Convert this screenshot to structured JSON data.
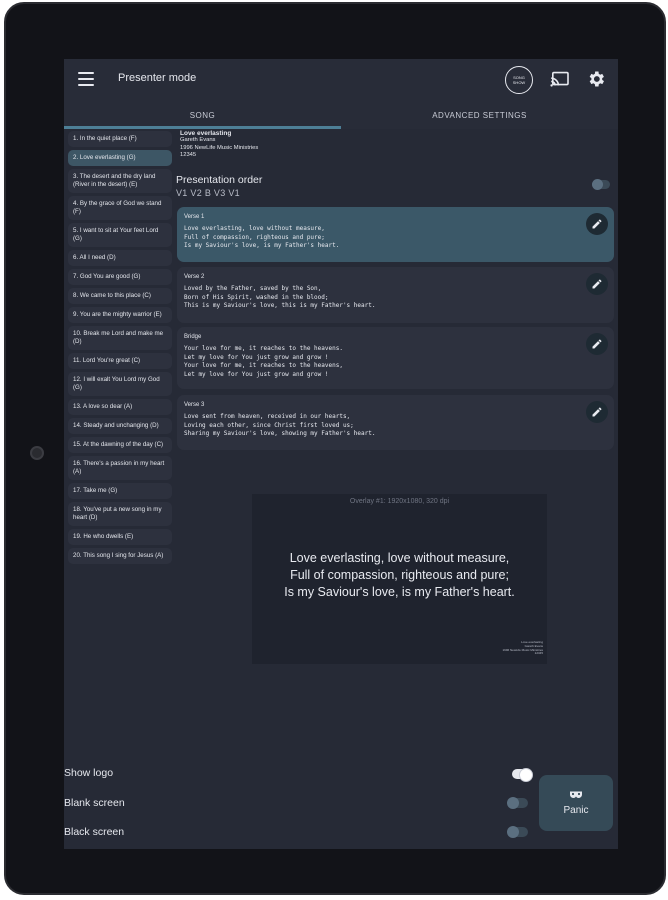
{
  "app": {
    "title": "Presenter mode",
    "logo_line1": "SONG",
    "logo_line2": "SHOW"
  },
  "icons": {
    "menu": "menu-icon",
    "cast": "cast-icon",
    "settings": "gear-icon",
    "edit": "pencil-icon",
    "panic": "mask-icon"
  },
  "tabs": [
    {
      "label": "SONG",
      "selected": true
    },
    {
      "label": "ADVANCED SETTINGS",
      "selected": false
    }
  ],
  "songs": [
    {
      "label": "1. In the quiet place (F)",
      "selected": false
    },
    {
      "label": "2. Love everlasting (G)",
      "selected": true
    },
    {
      "label": "3. The desert and the dry land (River in the desert) (E)",
      "selected": false
    },
    {
      "label": "4. By the grace of God we stand (F)",
      "selected": false
    },
    {
      "label": "5. I want to sit at Your feet Lord (G)",
      "selected": false
    },
    {
      "label": "6. All I need (D)",
      "selected": false
    },
    {
      "label": "7. God You are good (G)",
      "selected": false
    },
    {
      "label": "8. We came to this place (C)",
      "selected": false
    },
    {
      "label": "9. You are the mighty warrior (E)",
      "selected": false
    },
    {
      "label": "10. Break me Lord and make me (D)",
      "selected": false
    },
    {
      "label": "11. Lord You're great (C)",
      "selected": false
    },
    {
      "label": "12. I will exalt You Lord my God (G)",
      "selected": false
    },
    {
      "label": "13. A love so dear (A)",
      "selected": false
    },
    {
      "label": "14. Steady and unchanging (D)",
      "selected": false
    },
    {
      "label": "15. At the dawning of the day (C)",
      "selected": false
    },
    {
      "label": "16. There's a passion in my heart (A)",
      "selected": false
    },
    {
      "label": "17. Take me (G)",
      "selected": false
    },
    {
      "label": "18. You've put a new song in my heart (D)",
      "selected": false
    },
    {
      "label": "19. He who dwells (E)",
      "selected": false
    },
    {
      "label": "20. This song I sing for Jesus (A)",
      "selected": false
    }
  ],
  "song_info": {
    "title": "Love everlasting",
    "author": "Gareth Evans",
    "copyright": "1996 NewLife Music Ministries",
    "number": "12345"
  },
  "presentation_order": {
    "title": "Presentation order",
    "sequence": "V1 V2 B V3 V1",
    "enabled": false
  },
  "verses": [
    {
      "label": "Verse 1",
      "lines": [
        "Love everlasting, love without measure,",
        "Full of compassion, righteous and pure;",
        "Is my Saviour's love, is my Father's heart."
      ],
      "active": true
    },
    {
      "label": "Verse 2",
      "lines": [
        "Loved by the Father, saved by the Son,",
        "Born of His Spirit, washed in the blood;",
        "This is my Saviour's love, this is my Father's heart."
      ],
      "active": false
    },
    {
      "label": "Bridge",
      "lines": [
        "Your love for me, it reaches to the heavens.",
        "Let my love for You just grow and grow !",
        "Your love for me, it reaches to the heavens,",
        "Let my love for You just grow and grow !"
      ],
      "active": false
    },
    {
      "label": "Verse 3",
      "lines": [
        "Love sent from heaven, received in our hearts,",
        "Loving each other, since Christ first loved us;",
        "Sharing my Saviour's love, showing my Father's heart."
      ],
      "active": false
    }
  ],
  "preview": {
    "caption": "Overlay #1: 1920x1080, 320 dpi",
    "lines": [
      "Love everlasting, love without measure,",
      "Full of compassion, righteous and pure;",
      "Is my Saviour's love, is my Father's heart."
    ],
    "credits": [
      "Love everlasting",
      "Gareth Evans",
      "1996 NewLife Music Ministries",
      "12345"
    ]
  },
  "controls": [
    {
      "label": "Show logo",
      "on": true
    },
    {
      "label": "Blank screen",
      "on": false
    },
    {
      "label": "Black screen",
      "on": false
    }
  ],
  "panic_label": "Panic"
}
